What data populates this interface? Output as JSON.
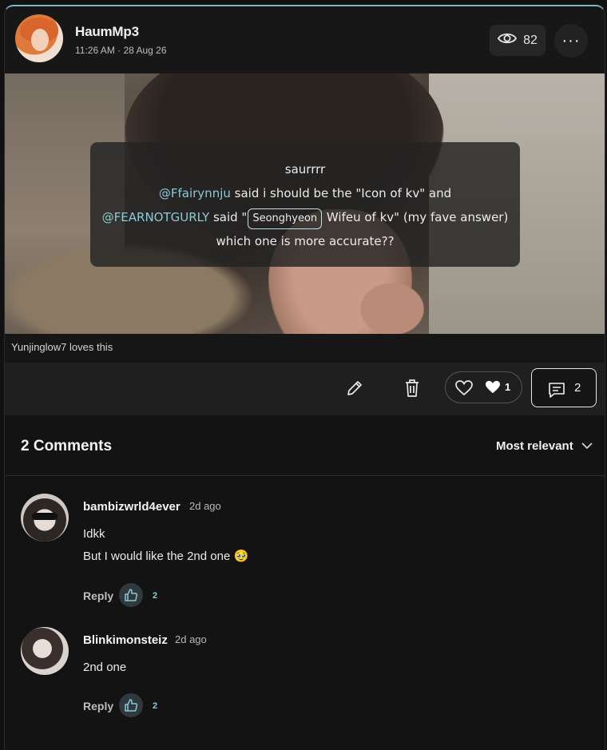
{
  "post": {
    "author": "HaumMp3",
    "timestamp": "11:26 AM · 28 Aug 26",
    "views": "82",
    "overlay": {
      "line1": "saurrrr",
      "mention1": "@Ffairynnju",
      "line2_rest": " said i should be the \"Icon of kv\" and",
      "mention2": "@FEARNOTGURLY",
      "line3_a": " said \"",
      "tag": "Seonghyeon",
      "line3_b": " Wifeu of kv\" (my fave answer)",
      "line4": "which one is more accurate??"
    },
    "loves_text": "Yunjinglow7 loves this",
    "reaction_count": "1",
    "comment_count": "2"
  },
  "comments_section": {
    "title": "2 Comments",
    "sort_label": "Most relevant",
    "items": [
      {
        "author": "bambizwrld4ever",
        "time": "2d ago",
        "lines": [
          "Idkk",
          "But I would like the 2nd one 🥹"
        ],
        "reply_label": "Reply",
        "likes": "2"
      },
      {
        "author": "Blinkimonsteiz",
        "time": "2d ago",
        "lines": [
          "2nd one"
        ],
        "reply_label": "Reply",
        "likes": "2"
      }
    ]
  },
  "colors": {
    "accent": "#8cc8d8",
    "background": "#131313",
    "action_bar": "#1f1f1f"
  },
  "icons": [
    "eye-icon",
    "more-icon",
    "pencil-icon",
    "trash-icon",
    "heart-outline-icon",
    "heart-filled-icon",
    "comment-icon",
    "chevron-down-icon",
    "thumbs-up-icon"
  ]
}
